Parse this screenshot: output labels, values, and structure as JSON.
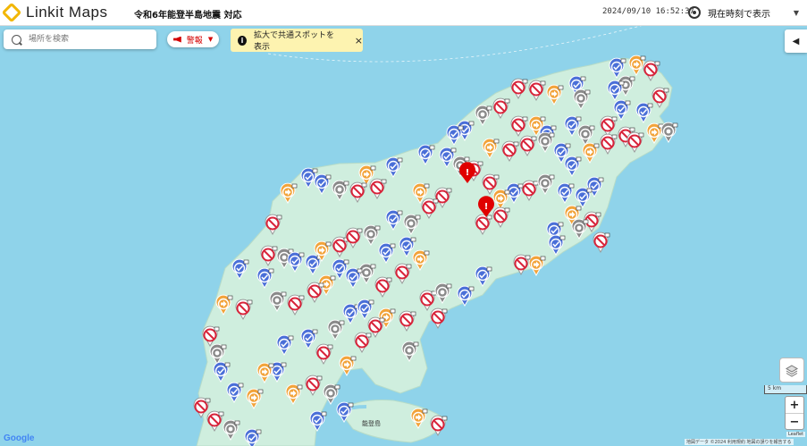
{
  "header": {
    "logo_text": "Linkit Maps",
    "subtitle": "令和6年能登半島地震 対応",
    "datetime": "2024/09/10 16:52:37",
    "time_select": "現在時刻で表示"
  },
  "search": {
    "placeholder": "場所を検索"
  },
  "alert_button": {
    "label": "警報"
  },
  "notice": {
    "text": "拡大で共通スポットを表示",
    "close": "×"
  },
  "map": {
    "place_label": "能登島",
    "scale_label": "5 km",
    "zoom_in": "+",
    "zoom_out": "−",
    "attribution": "地図データ ©2024 利用規約 地図の誤りを報告する",
    "leaflet": "Leaflet",
    "google": "Google",
    "colors": {
      "sea": "#8fd3ea",
      "land": "#cfeede",
      "blue_marker": "#4a6fd8",
      "gray_marker": "#8a8a8a",
      "orange_marker": "#f2a33a",
      "no_entry_marker": "#d8243a",
      "alert_marker": "#e00000"
    }
  }
}
